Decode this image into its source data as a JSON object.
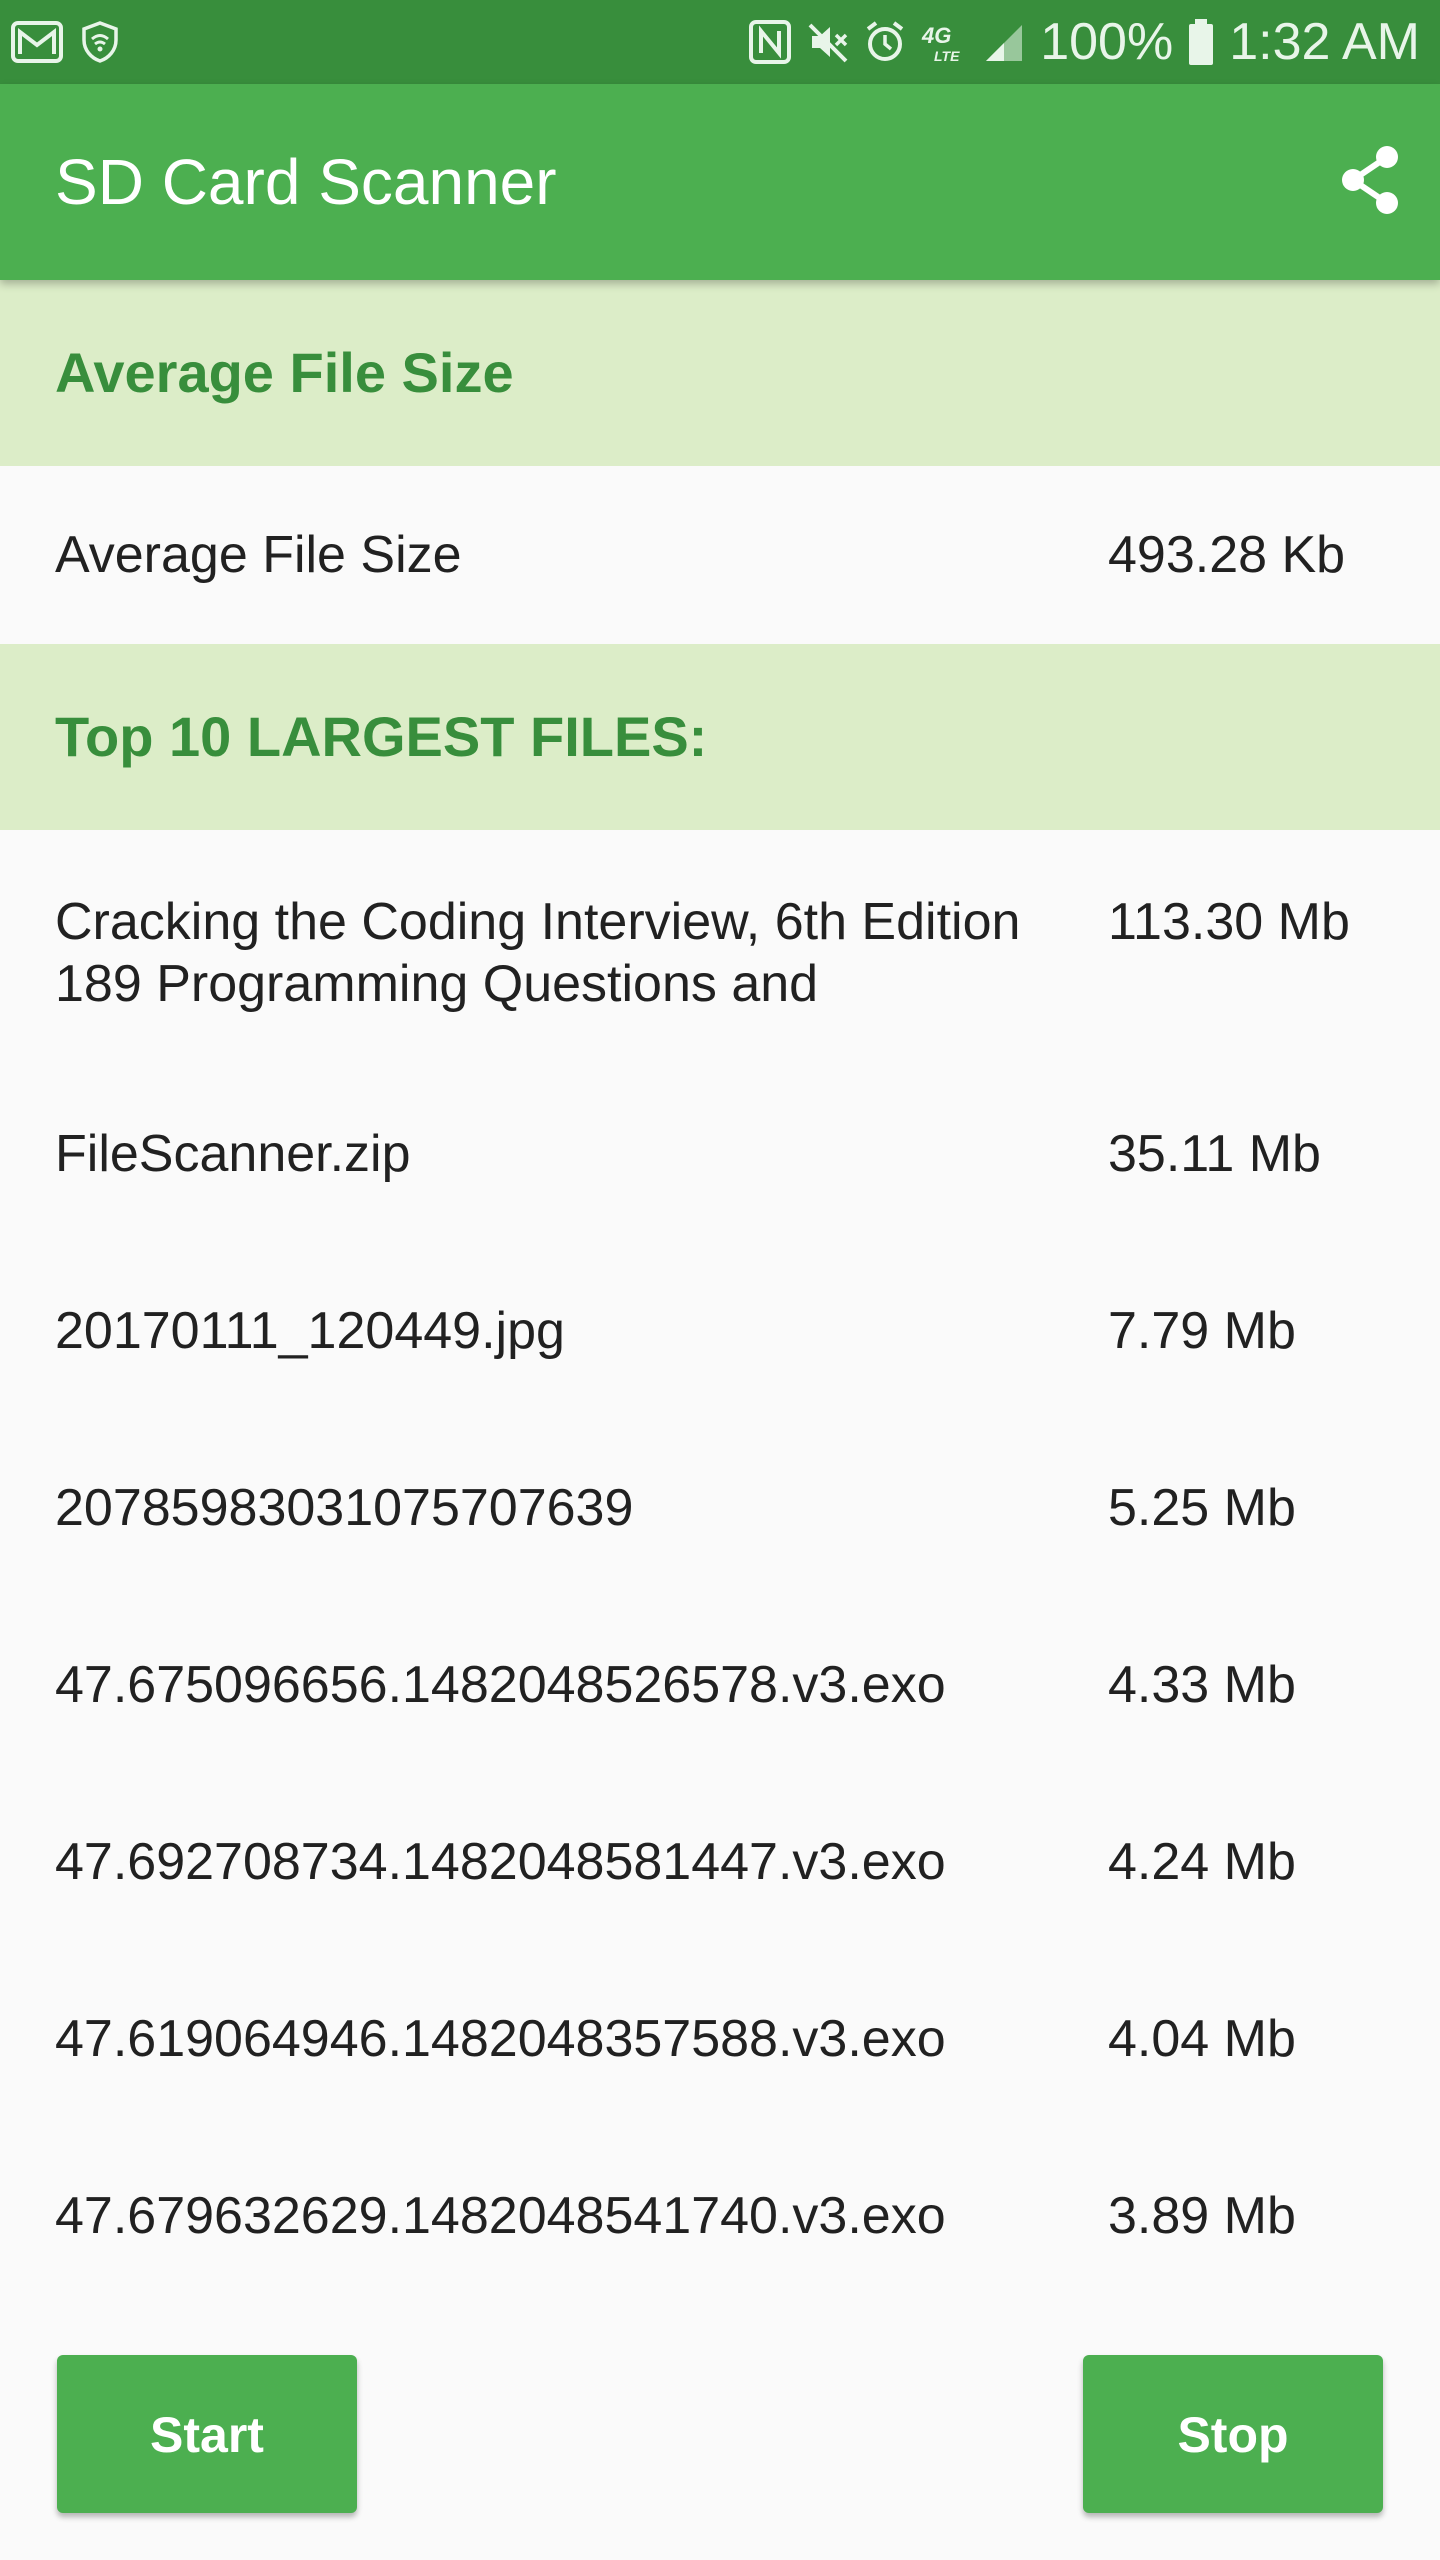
{
  "status_bar": {
    "battery": "100%",
    "time": "1:32 AM",
    "network_label": "4G LTE",
    "icons": [
      "gmail-icon",
      "wifi-shield-icon",
      "nfc-icon",
      "mute-icon",
      "alarm-icon",
      "lte-icon",
      "signal-icon",
      "battery-icon"
    ]
  },
  "app_bar": {
    "title": "SD Card Scanner",
    "action_icon": "share-icon"
  },
  "sections": {
    "average": {
      "header": "Average File Size",
      "label": "Average File Size",
      "value": "493.28 Kb"
    },
    "largest": {
      "header": "Top 10 LARGEST FILES:",
      "files": [
        {
          "name": "Cracking the Coding Interview, 6th Edition 189 Programming Questions and",
          "size": "113.30 Mb"
        },
        {
          "name": "FileScanner.zip",
          "size": "35.11 Mb"
        },
        {
          "name": "20170111_120449.jpg",
          "size": "7.79 Mb"
        },
        {
          "name": "2078598303107570763​9",
          "size": "5.25 Mb"
        },
        {
          "name": "47.675096656.1482048526578.v3.exo",
          "size": "4.33 Mb"
        },
        {
          "name": "47.692708734.1482048581447.v3.exo",
          "size": "4.24 Mb"
        },
        {
          "name": "47.619064946.1482048357588.v3.exo",
          "size": "4.04 Mb"
        },
        {
          "name": "47.679632629.1482048541740.v3.exo",
          "size": "3.89 Mb"
        }
      ]
    }
  },
  "buttons": {
    "start": "Start",
    "stop": "Stop"
  },
  "colors": {
    "status_bar": "#388E3C",
    "app_bar": "#4CAF50",
    "section_header_bg": "#DCEDC8",
    "section_header_text": "#388E3C",
    "background": "#FAFAFA"
  }
}
